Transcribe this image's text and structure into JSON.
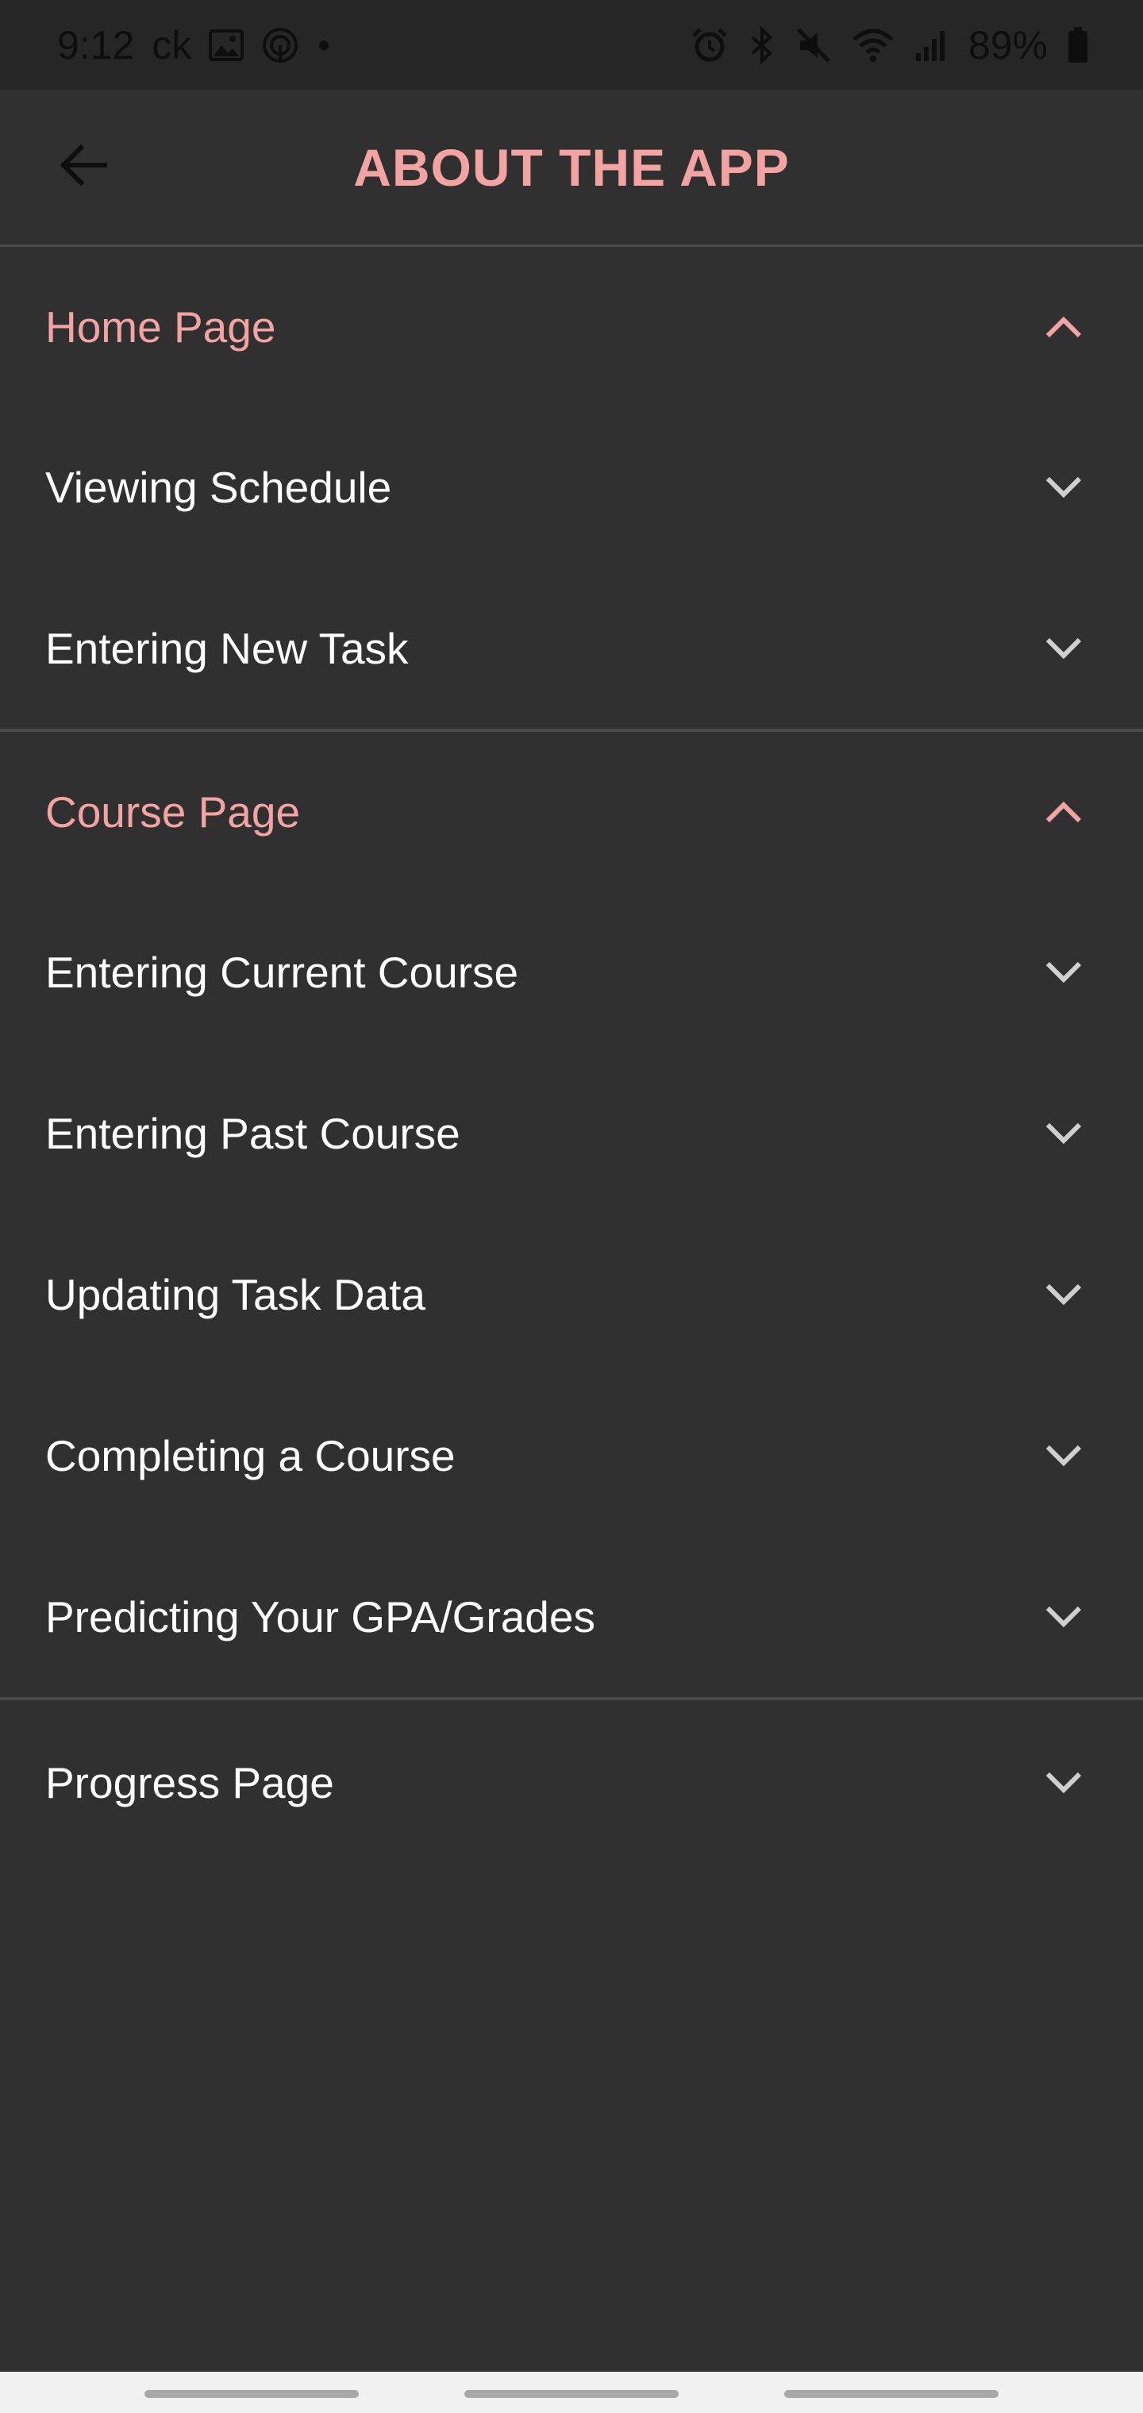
{
  "status_bar": {
    "time": "9:12",
    "carrier_tag": "ck",
    "battery": "89%",
    "icons": [
      "image-icon",
      "focus-icon",
      "dot-icon",
      "alarm-icon",
      "bluetooth-icon",
      "mute-icon",
      "wifi-icon",
      "signal-icon",
      "battery-icon"
    ]
  },
  "app_bar": {
    "title": "ABOUT THE APP",
    "back_icon": "arrow-back-icon"
  },
  "sections": [
    {
      "header": "Home Page",
      "expanded": true,
      "items": [
        "Viewing Schedule",
        "Entering New Task"
      ]
    },
    {
      "header": "Course Page",
      "expanded": true,
      "items": [
        "Entering Current Course",
        "Entering Past Course",
        "Updating Task Data",
        "Completing a Course",
        "Predicting Your GPA/Grades"
      ]
    },
    {
      "header": "Progress Page",
      "expanded": false,
      "items": []
    }
  ],
  "colors": {
    "accent": "#f4a3a3",
    "background": "#303030",
    "status_bar": "#262626",
    "text": "#ffffff",
    "chevron": "#cfcfcf",
    "divider": "#4a4a4a"
  }
}
